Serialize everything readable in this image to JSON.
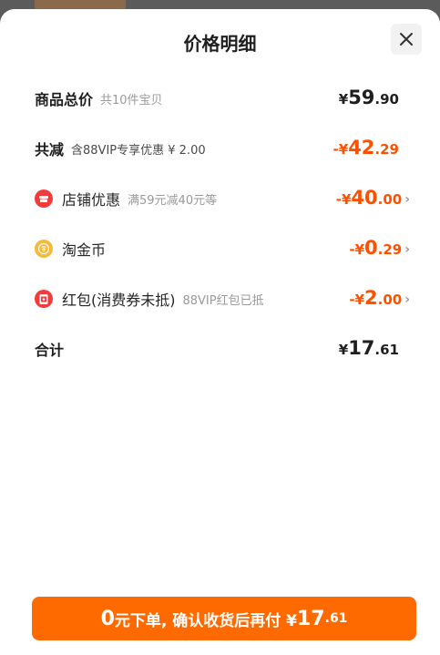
{
  "header": {
    "title": "价格明细"
  },
  "rows": {
    "subtotal": {
      "label": "商品总价",
      "note": "共10件宝贝",
      "amount": {
        "yen": "¥",
        "int": "59",
        "dec": ".90"
      }
    },
    "reduction": {
      "label": "共减",
      "note": "含88VIP专享优惠 ¥ 2.00",
      "amount": {
        "yen": "-¥",
        "int": "42",
        "dec": ".29"
      }
    },
    "store": {
      "label": "店铺优惠",
      "note": "满59元减40元等",
      "amount": {
        "yen": "-¥",
        "int": "40",
        "dec": ".00"
      }
    },
    "coin": {
      "label": "淘金币",
      "amount": {
        "yen": "-¥",
        "int": "0",
        "dec": ".29"
      }
    },
    "redpacket": {
      "label": "红包(消费券未抵)",
      "note": "88VIP红包已抵",
      "amount": {
        "yen": "-¥",
        "int": "2",
        "dec": ".00"
      }
    },
    "total": {
      "label": "合计",
      "amount": {
        "yen": "¥",
        "int": "17",
        "dec": ".61"
      }
    }
  },
  "cta": {
    "prefix_num": "0",
    "text": "元下单, 确认收货后再付 ¥",
    "int": "17",
    "dec": ".61"
  },
  "icons": {
    "close": "close-icon",
    "store": "store-icon",
    "coin": "coin-icon",
    "redpacket": "red-packet-icon",
    "chevron": "chevron-right-icon"
  },
  "colors": {
    "accent": "#ff5000",
    "button": "#ff6a00",
    "store_icon": "#f23c3c",
    "coin_icon": "#f6b93b"
  }
}
